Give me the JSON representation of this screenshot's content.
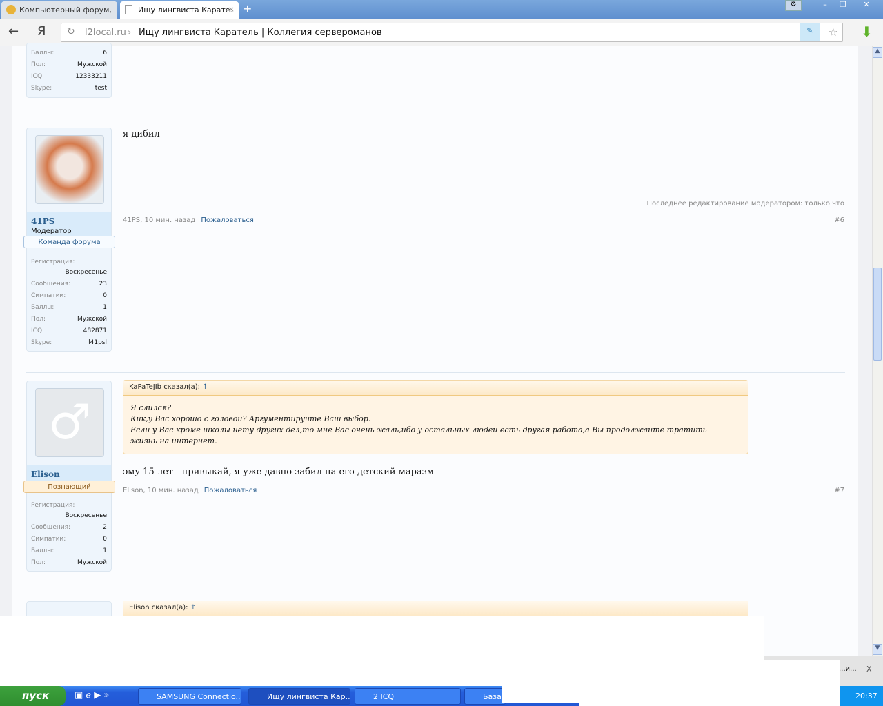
{
  "browser": {
    "tabs": [
      {
        "label": "Компьютерный форум,"
      },
      {
        "label": "Ищу лингвиста Карате.",
        "close": "×"
      }
    ],
    "new_tab": "+",
    "host": "l2local.ru",
    "sep": "›",
    "page_title": "Ищу лингвиста Каратель | Коллегия сервероманов",
    "yandex": "Я"
  },
  "prev_user": {
    "stats": [
      {
        "k": "Баллы:",
        "v": "6"
      },
      {
        "k": "Пол:",
        "v": "Мужской"
      },
      {
        "k": "ICQ:",
        "v": "12333211"
      },
      {
        "k": "Skype:",
        "v": "test"
      }
    ]
  },
  "posts": [
    {
      "user": "41PS",
      "title": "Модератор",
      "ribbon": "Команда форума",
      "stats": [
        {
          "k": "Регистрация:",
          "v": ""
        },
        {
          "k": "",
          "v": "Воскресенье"
        },
        {
          "k": "Сообщения:",
          "v": "23"
        },
        {
          "k": "Симпатии:",
          "v": "0"
        },
        {
          "k": "Баллы:",
          "v": "1"
        },
        {
          "k": "Пол:",
          "v": "Мужской"
        },
        {
          "k": "ICQ:",
          "v": "482871"
        },
        {
          "k": "Skype:",
          "v": "l41psl"
        }
      ],
      "text": "я дибил",
      "edited": "Последнее редактирование модератором: только что",
      "meta": "41PS, 10 мин. назад",
      "report": "Пожаловаться",
      "num": "#6"
    },
    {
      "user": "Elison",
      "ribbon": "Познающий",
      "stats": [
        {
          "k": "Регистрация:",
          "v": ""
        },
        {
          "k": "",
          "v": "Воскресенье"
        },
        {
          "k": "Сообщения:",
          "v": "2"
        },
        {
          "k": "Симпатии:",
          "v": "0"
        },
        {
          "k": "Баллы:",
          "v": "1"
        },
        {
          "k": "Пол:",
          "v": "Мужской"
        }
      ],
      "quote_head": "KaPaTeJIb сказал(а):",
      "quote_arrow": "↑",
      "quote_lines": [
        "Я слился?",
        "Кик,у Вас хорошо с головой? Аргументируйте Ваш выбор.",
        "Если у Вас кроме школы нету других дел,то мне Вас очень жаль,ибо у остальных людей есть другая работа,а Вы продолжайте тратить",
        "жизнь на интернет."
      ],
      "text": "эму 15 лет - привыкай, я уже давно забил на его детский маразм",
      "meta": "Elison, 10 мин. назад",
      "report": "Пожаловаться",
      "num": "#7"
    },
    {
      "quote_head": "Elison сказал(а):",
      "quote_arrow": "↑"
    }
  ],
  "download_bar": {
    "item": "...и...",
    "close": "X"
  },
  "taskbar": {
    "start": "пуск",
    "items": [
      "SAMSUNG Connectio...",
      "Ищу лингвиста Кар...",
      "2 ICQ",
      "База д"
    ],
    "clock": "20:37"
  }
}
